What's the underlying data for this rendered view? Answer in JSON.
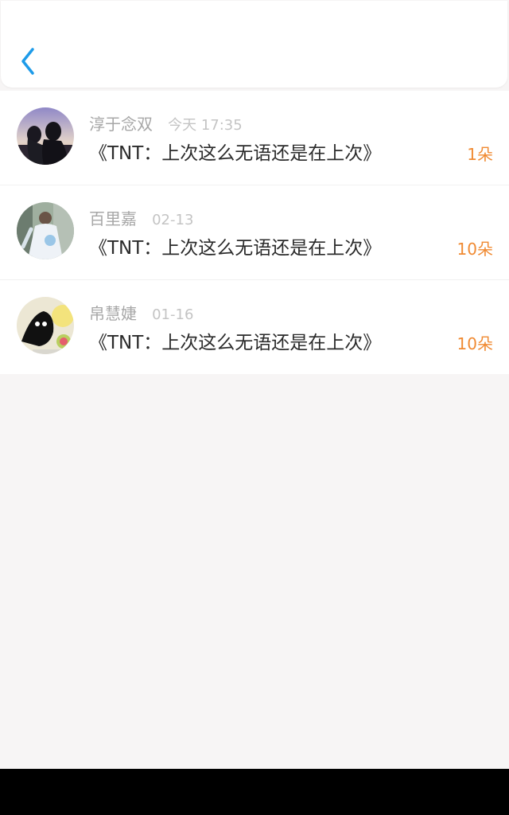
{
  "colors": {
    "accent": "#1e9be9",
    "count": "#f08a32",
    "name": "#a7a7a7",
    "time": "#c4c4c4",
    "text": "#2b2b2b",
    "background": "#f7f5f5"
  },
  "header": {
    "back_icon": "chevron-left-icon"
  },
  "items": [
    {
      "name": "淳于念双",
      "time": "今天 17:35",
      "message": "《TNT：上次这么无语还是在上次》",
      "count": "1朵"
    },
    {
      "name": "百里嘉",
      "time": "02-13",
      "message": "《TNT：上次这么无语还是在上次》",
      "count": "10朵"
    },
    {
      "name": "帛慧婕",
      "time": "01-16",
      "message": "《TNT：上次这么无语还是在上次》",
      "count": "10朵"
    }
  ]
}
